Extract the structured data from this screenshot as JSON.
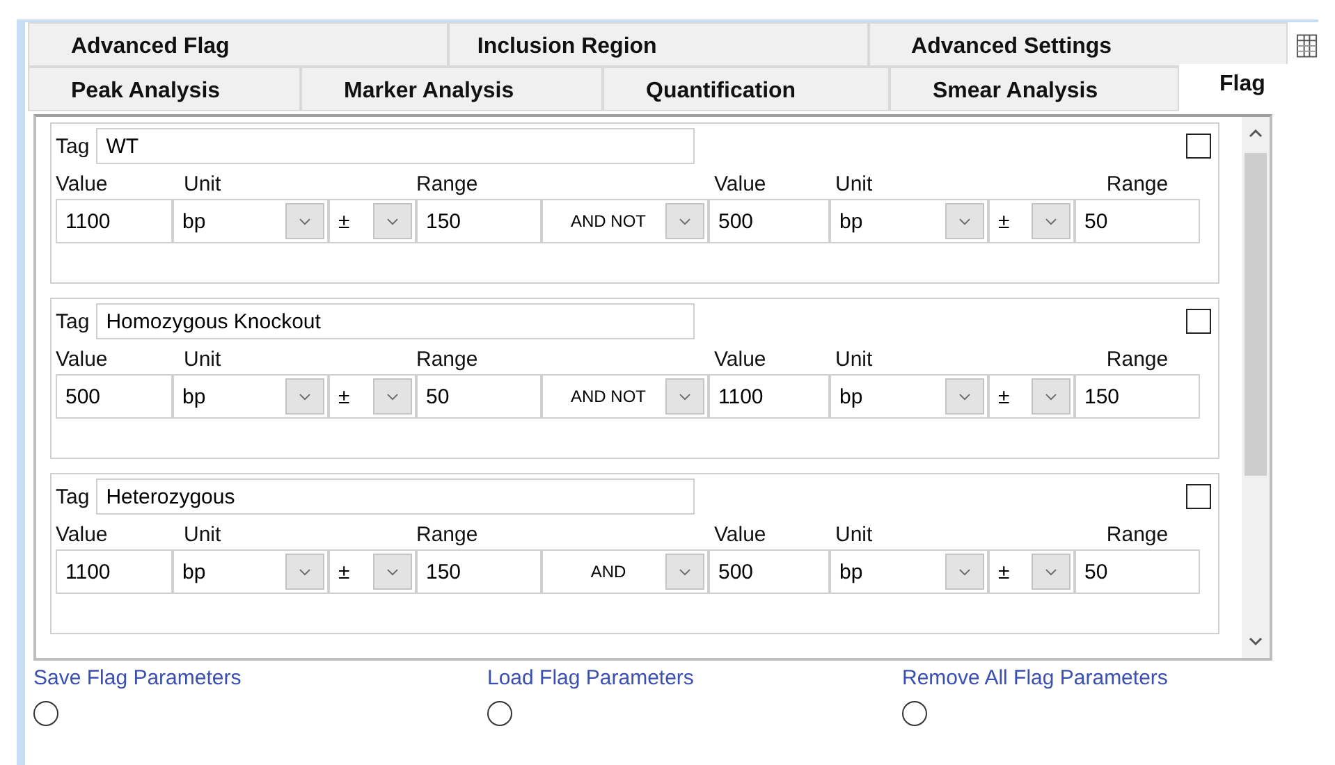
{
  "tab_rows": [
    [
      {
        "label": "Advanced Flag",
        "selected": false
      },
      {
        "label": "Inclusion Region",
        "selected": false
      },
      {
        "label": "Advanced Settings",
        "selected": false
      }
    ],
    [
      {
        "label": "Peak Analysis",
        "selected": false
      },
      {
        "label": "Marker Analysis",
        "selected": false
      },
      {
        "label": "Quantification",
        "selected": false
      },
      {
        "label": "Smear Analysis",
        "selected": false
      },
      {
        "label": "Flag",
        "selected": true
      }
    ]
  ],
  "flags": [
    {
      "tag_label": "Tag",
      "tag": "WT",
      "checked": false,
      "headers": [
        "Value",
        "Unit",
        "Range",
        "Value",
        "Unit",
        "Range"
      ],
      "left": {
        "value": "1100",
        "unit": "bp",
        "sign": "±",
        "range": "150"
      },
      "operator": "AND NOT",
      "right": {
        "value": "500",
        "unit": "bp",
        "sign": "±",
        "range": "50"
      }
    },
    {
      "tag_label": "Tag",
      "tag": "Homozygous Knockout",
      "checked": false,
      "headers": [
        "Value",
        "Unit",
        "Range",
        "Value",
        "Unit",
        "Range"
      ],
      "left": {
        "value": "500",
        "unit": "bp",
        "sign": "±",
        "range": "50"
      },
      "operator": "AND NOT",
      "right": {
        "value": "1100",
        "unit": "bp",
        "sign": "±",
        "range": "150"
      }
    },
    {
      "tag_label": "Tag",
      "tag": "Heterozygous",
      "checked": false,
      "headers": [
        "Value",
        "Unit",
        "Range",
        "Value",
        "Unit",
        "Range"
      ],
      "left": {
        "value": "1100",
        "unit": "bp",
        "sign": "±",
        "range": "150"
      },
      "operator": "AND",
      "right": {
        "value": "500",
        "unit": "bp",
        "sign": "±",
        "range": "50"
      }
    }
  ],
  "actions": [
    {
      "label": "Save Flag Parameters",
      "selected": false
    },
    {
      "label": "Load Flag Parameters",
      "selected": false
    },
    {
      "label": "Remove All Flag Parameters",
      "selected": false
    }
  ]
}
